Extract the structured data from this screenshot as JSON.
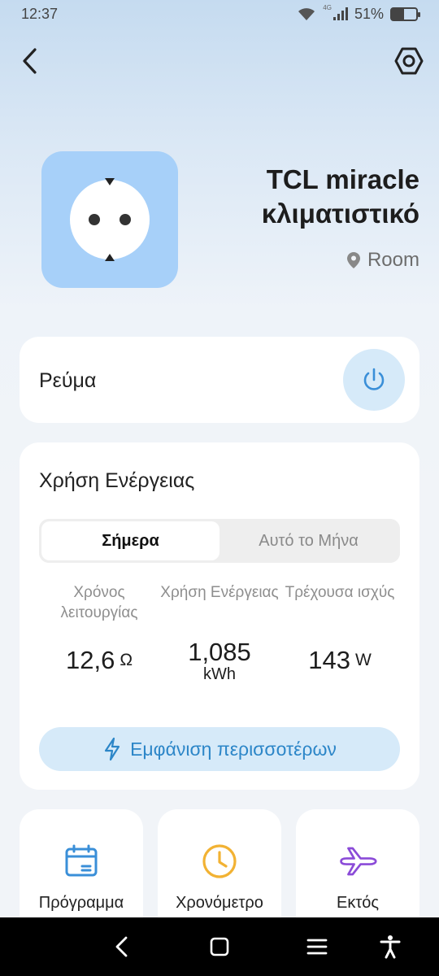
{
  "status_bar": {
    "time": "12:37",
    "network": "4G",
    "battery_percent": "51%",
    "battery_level": 0.51
  },
  "nav": {
    "back_icon": "chevron-left-icon",
    "settings_icon": "hexagon-gear-icon"
  },
  "device": {
    "name": "TCL miracle κλιματιστικό",
    "room": "Room",
    "icon": "smart-plug-icon",
    "icon_bg": "#a7d0f9"
  },
  "power": {
    "label": "Ρεύμα",
    "icon": "power-icon"
  },
  "energy": {
    "title": "Χρήση Ενέργειας",
    "tabs": [
      {
        "label": "Σήμερα",
        "active": true
      },
      {
        "label": "Αυτό το Μήνα",
        "active": false
      }
    ],
    "stats": [
      {
        "label": "Χρόνος λειτουργίας",
        "value": "12,6",
        "unit": "Ω"
      },
      {
        "label": "Χρήση Ενέργειας",
        "value": "1,085",
        "unit": "kWh"
      },
      {
        "label": "Τρέχουσα ισχύς",
        "value": "143",
        "unit": "W"
      }
    ],
    "more_button": "Εμφάνιση περισσοτέρων"
  },
  "features": [
    {
      "label": "Πρόγραμμα",
      "icon": "calendar-icon",
      "color": "#3a8fd8"
    },
    {
      "label": "Χρονόμετρο",
      "icon": "clock-icon",
      "color": "#f2b233"
    },
    {
      "label": "Εκτός",
      "icon": "airplane-icon",
      "color": "#8b4bd8"
    }
  ],
  "colors": {
    "accent": "#2c86c8",
    "accent_bg": "#d6eaf9"
  }
}
